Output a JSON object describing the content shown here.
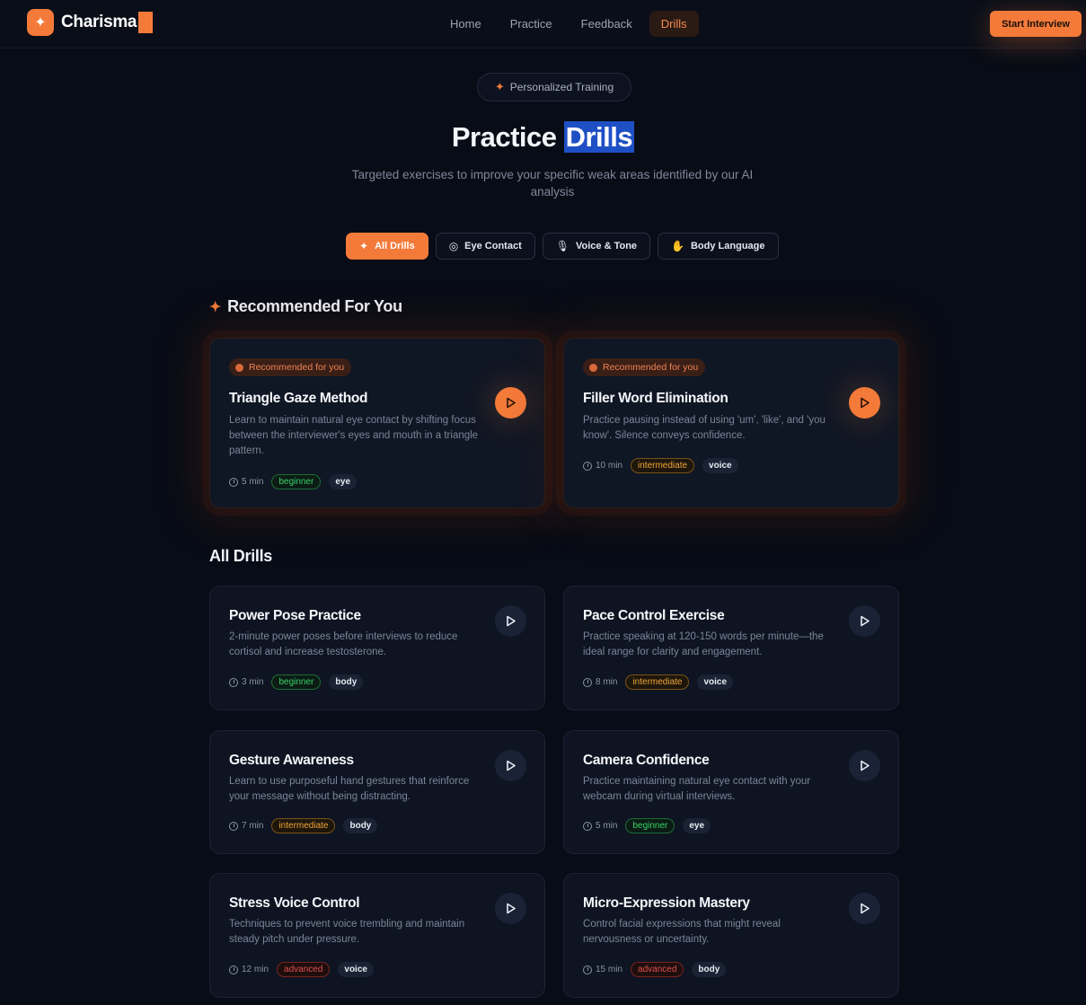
{
  "nav": {
    "brand": "Charisma",
    "links": [
      "Home",
      "Practice",
      "Feedback",
      "Drills"
    ],
    "active": "Drills",
    "cta": "Start Interview"
  },
  "hero": {
    "pill": "Personalized Training",
    "title_part1": "Practice",
    "title_part2": "Drills",
    "subtitle": "Targeted exercises to improve your specific weak areas identified by our AI analysis"
  },
  "filters": [
    {
      "label": "All Drills",
      "icon": "sparkles-icon"
    },
    {
      "label": "Eye Contact",
      "icon": "eye-icon"
    },
    {
      "label": "Voice & Tone",
      "icon": "mic-icon"
    },
    {
      "label": "Body Language",
      "icon": "hand-icon"
    }
  ],
  "recommended": {
    "title": "Recommended For You",
    "badge": "Recommended for you",
    "items": [
      {
        "title": "Triangle Gaze Method",
        "desc": "Learn to maintain natural eye contact by shifting focus between the interviewer's eyes and mouth in a triangle pattern.",
        "time": "5 min",
        "level": "beginner",
        "tag": "eye"
      },
      {
        "title": "Filler Word Elimination",
        "desc": "Practice pausing instead of using 'um', 'like', and 'you know'. Silence conveys confidence.",
        "time": "10 min",
        "level": "intermediate",
        "tag": "voice"
      }
    ]
  },
  "all": {
    "title": "All Drills",
    "items": [
      {
        "title": "Power Pose Practice",
        "desc": "2-minute power poses before interviews to reduce cortisol and increase testosterone.",
        "time": "3 min",
        "level": "beginner",
        "tag": "body"
      },
      {
        "title": "Pace Control Exercise",
        "desc": "Practice speaking at 120-150 words per minute—the ideal range for clarity and engagement.",
        "time": "8 min",
        "level": "intermediate",
        "tag": "voice"
      },
      {
        "title": "Gesture Awareness",
        "desc": "Learn to use purposeful hand gestures that reinforce your message without being distracting.",
        "time": "7 min",
        "level": "intermediate",
        "tag": "body"
      },
      {
        "title": "Camera Confidence",
        "desc": "Practice maintaining natural eye contact with your webcam during virtual interviews.",
        "time": "5 min",
        "level": "beginner",
        "tag": "eye"
      },
      {
        "title": "Stress Voice Control",
        "desc": "Techniques to prevent voice trembling and maintain steady pitch under pressure.",
        "time": "12 min",
        "level": "advanced",
        "tag": "voice"
      },
      {
        "title": "Micro-Expression Mastery",
        "desc": "Control facial expressions that might reveal nervousness or uncertainty.",
        "time": "15 min",
        "level": "advanced",
        "tag": "body"
      }
    ]
  },
  "colors": {
    "accent": "#f47a3a",
    "background": "#080c16",
    "highlight": "#1f4fc4"
  }
}
